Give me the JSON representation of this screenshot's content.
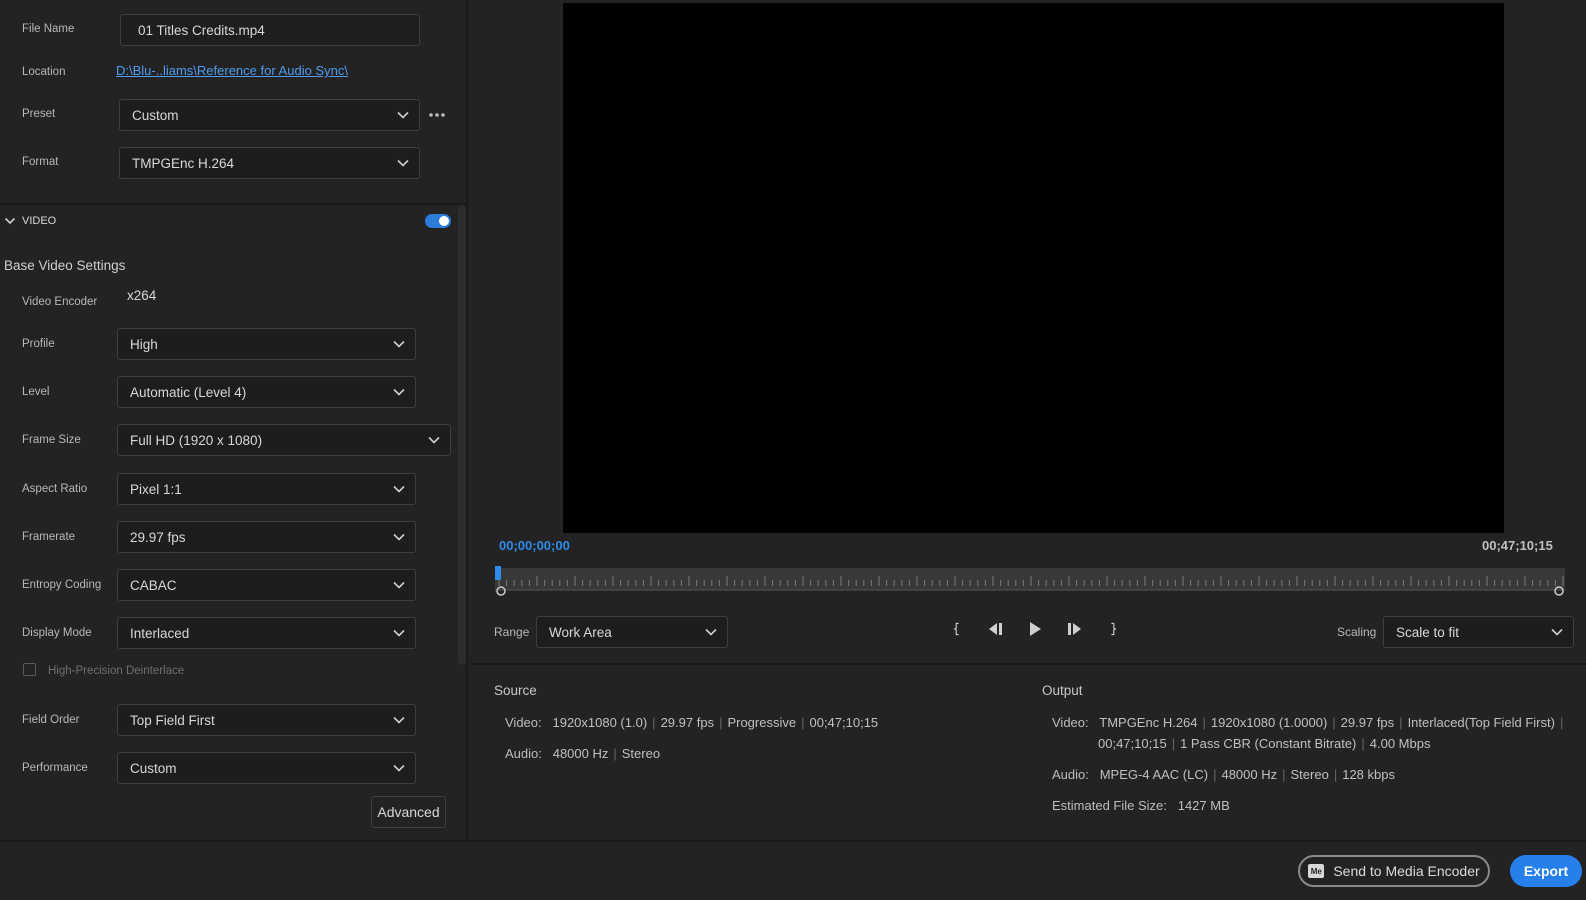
{
  "top_fields": {
    "file_name_label": "File Name",
    "file_name_value": "01 Titles Credits.mp4",
    "location_label": "Location",
    "location_value": "D:\\Blu-..liams\\Reference for Audio Sync\\",
    "preset_label": "Preset",
    "preset_value": "Custom",
    "format_label": "Format",
    "format_value": "TMPGEnc H.264"
  },
  "video_section": {
    "title": "VIDEO",
    "enabled": true,
    "subheading": "Base Video Settings",
    "encoder_label": "Video Encoder",
    "encoder_value": "x264",
    "settings": [
      {
        "label": "Profile",
        "value": "High"
      },
      {
        "label": "Level",
        "value": "Automatic (Level 4)"
      },
      {
        "label": "Frame Size",
        "value": "Full HD (1920 x 1080)"
      },
      {
        "label": "Aspect Ratio",
        "value": "Pixel 1:1"
      },
      {
        "label": "Framerate",
        "value": "29.97 fps"
      },
      {
        "label": "Entropy Coding",
        "value": "CABAC"
      },
      {
        "label": "Display Mode",
        "value": "Interlaced"
      }
    ],
    "checkbox_label": "High-Precision Deinterlace",
    "checkbox_checked": false,
    "settings2": [
      {
        "label": "Field Order",
        "value": "Top Field First"
      },
      {
        "label": "Performance",
        "value": "Custom"
      }
    ],
    "advanced_label": "Advanced"
  },
  "preview": {
    "timecode_start": "00;00;00;00",
    "timecode_end": "00;47;10;15",
    "range_label": "Range",
    "range_value": "Work Area",
    "scaling_label": "Scaling",
    "scaling_value": "Scale to fit"
  },
  "source": {
    "title": "Source",
    "video_label": "Video:",
    "video_parts": [
      "1920x1080 (1.0)",
      "29.97 fps",
      "Progressive",
      "00;47;10;15"
    ],
    "audio_label": "Audio:",
    "audio_parts": [
      "48000 Hz",
      "Stereo"
    ]
  },
  "output": {
    "title": "Output",
    "video_label": "Video:",
    "video_parts_line1": [
      "TMPGEnc H.264",
      "1920x1080 (1.0000)",
      "29.97 fps",
      "Interlaced(Top Field First)"
    ],
    "video_parts_line2": [
      "00;47;10;15",
      "1 Pass CBR (Constant Bitrate)",
      "4.00 Mbps"
    ],
    "audio_label": "Audio:",
    "audio_parts": [
      "MPEG-4 AAC (LC)",
      "48000 Hz",
      "Stereo",
      "128 kbps"
    ],
    "size_label": "Estimated File Size:",
    "size_value": "1427 MB"
  },
  "footer": {
    "send_label": "Send to Media Encoder",
    "me_badge": "Me",
    "export_label": "Export"
  },
  "colors": {
    "accent": "#2680eb",
    "timecode": "#2d8ceb",
    "link": "#4f9cf0"
  }
}
